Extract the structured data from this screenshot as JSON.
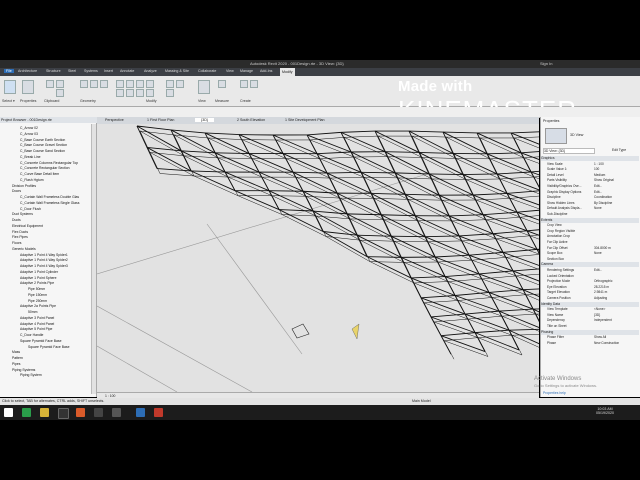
{
  "window": {
    "title": "Autodesk Revit 2020 - 001Design.rte - 3D View: {3D}",
    "sign_in": "Sign In"
  },
  "ribbon_tabs": [
    "File",
    "Architecture",
    "Structure",
    "Steel",
    "Systems",
    "Insert",
    "Annotate",
    "Analyze",
    "Massing & Site",
    "Collaborate",
    "View",
    "Manage",
    "Add-Ins",
    "Modify"
  ],
  "ribbon_panels": [
    "Select ▾",
    "Properties",
    "Clipboard",
    "Geometry",
    "Modify",
    "View",
    "Measure",
    "Create"
  ],
  "watermark": {
    "small": "Made with",
    "big": "KINEMASTER"
  },
  "project_browser": {
    "title": "Project Browser - 001Design.rte",
    "items": [
      "C_Arrow 02",
      "C_Arrow 03",
      "C_Base Course Earth Section",
      "C_Base Course Gravel Section",
      "C_Base Course Sand Section",
      "C_Break Line",
      "C_Concrete Columns Rectangular Top",
      "C_Concrete Rectangular Section",
      "C_Curve Base Detail Item",
      "C_Flash Hgtum",
      "Division Profiles",
      "Doors",
      "C_Curtain Wall Frameless Double Glas",
      "C_Curtain Wall Frameless Single Glass",
      "C_Door Flush",
      "Duct Systems",
      "Ducts",
      "Electrical Equipment",
      "Flex Ducts",
      "Flex Pipes",
      "Floors",
      "Generic Models",
      "Adaptive 1 Point 4 Way Spider1",
      "Adaptive 1 Point 4 Way Spider2",
      "Adaptive 1 Point 4 Way Spider3",
      "Adaptive 1 Point Cylinder",
      "Adaptive 1 Point Sphere",
      "Adaptive 2 Points Pipe",
      "Pipe 50mm",
      "Pipe 150mm",
      "Pipe 250mm",
      "Adaptive 2a Points Pipe",
      "50mm",
      "Adaptive 3 Point Panel",
      "Adaptive 4 Point Panel",
      "Adaptive 5 Point Pipe",
      "C_Door Handle",
      "Square Pyramid Face Base",
      "Square Pyramid Face Base",
      "Mass",
      "Pattern",
      "Pipes",
      "Piping Systems",
      "Piping System"
    ]
  },
  "view_tabs": [
    "Perspective",
    "1 First Floor Plan",
    "{3D}",
    "2 South Elevation",
    "1 Site Development Plan"
  ],
  "view_bar": {
    "scale": "1 : 100"
  },
  "properties": {
    "title": "Properties",
    "type": "3D View",
    "selector": "3D View: {3D}",
    "edit_type": "Edit Type",
    "groups": [
      {
        "name": "Graphics",
        "rows": [
          [
            "View Scale",
            "1 : 100"
          ],
          [
            "Scale Value 1:",
            "100"
          ],
          [
            "Detail Level",
            "Medium"
          ],
          [
            "Parts Visibility",
            "Show Original"
          ],
          [
            "Visibility/Graphics Ove...",
            "Edit..."
          ],
          [
            "Graphic Display Options",
            "Edit..."
          ],
          [
            "Discipline",
            "Coordination"
          ],
          [
            "Show Hidden Lines",
            "By Discipline"
          ],
          [
            "Default Analysis Displa...",
            "None"
          ],
          [
            "Sub-Discipline",
            ""
          ]
        ]
      },
      {
        "name": "Extents",
        "rows": [
          [
            "Crop View",
            ""
          ],
          [
            "Crop Region Visible",
            ""
          ],
          [
            "Annotation Crop",
            ""
          ],
          [
            "Far Clip Active",
            ""
          ],
          [
            "Far Clip Offset",
            "304.8000 m"
          ],
          [
            "Scope Box",
            "None"
          ],
          [
            "Section Box",
            ""
          ]
        ]
      },
      {
        "name": "Camera",
        "rows": [
          [
            "Rendering Settings",
            "Edit..."
          ],
          [
            "Locked Orientation",
            ""
          ],
          [
            "Projection Mode",
            "Orthographic"
          ],
          [
            "Eye Elevation",
            "28.2215 m"
          ],
          [
            "Target Elevation",
            "2.9841 m"
          ],
          [
            "Camera Position",
            "Adjusting"
          ]
        ]
      },
      {
        "name": "Identity Data",
        "rows": [
          [
            "View Template",
            "<None>"
          ],
          [
            "View Name",
            "{3D}"
          ],
          [
            "Dependency",
            "Independent"
          ],
          [
            "Title on Sheet",
            ""
          ]
        ]
      },
      {
        "name": "Phasing",
        "rows": [
          [
            "Phase Filter",
            "Show All"
          ],
          [
            "Phase",
            "New Construction"
          ]
        ]
      }
    ],
    "help": "Properties help"
  },
  "activate": {
    "line1": "Activate Windows",
    "line2": "Go to Settings to activate Windows."
  },
  "status": {
    "text": "Click to select, TAB for alternates, CTRL adds, SHIFT unselects.",
    "model": "Main Model"
  },
  "clock": {
    "time": "10:03 AM",
    "date": "05/19/2020"
  },
  "colors": {
    "accent": "#2d6db5",
    "titlebar": "#2b2b2b",
    "viewport": "#e2e2e2"
  }
}
